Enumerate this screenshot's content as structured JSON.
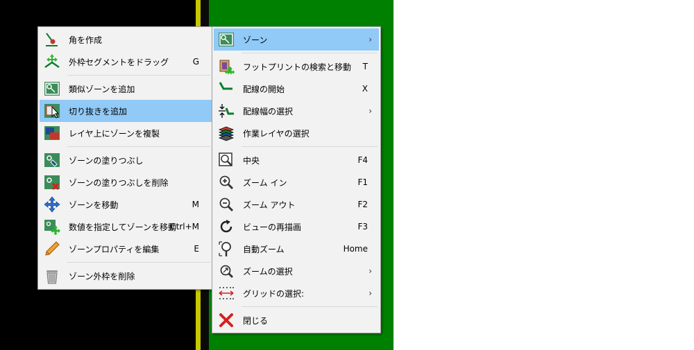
{
  "left_menu": {
    "items": [
      {
        "label": "角を作成",
        "shortcut": "",
        "icon": "create-corner-icon"
      },
      {
        "label": "外枠セグメントをドラッグ",
        "shortcut": "G",
        "icon": "drag-segment-icon"
      },
      {
        "label": "類似ゾーンを追加",
        "shortcut": "",
        "icon": "add-similar-zone-icon"
      },
      {
        "label": "切り抜きを追加",
        "shortcut": "",
        "icon": "add-cutout-icon"
      },
      {
        "label": "レイヤ上にゾーンを複製",
        "shortcut": "",
        "icon": "duplicate-zone-icon"
      },
      {
        "label": "ゾーンの塗りつぶし",
        "shortcut": "",
        "icon": "fill-zone-icon"
      },
      {
        "label": "ゾーンの塗りつぶしを削除",
        "shortcut": "",
        "icon": "unfill-zone-icon"
      },
      {
        "label": "ゾーンを移動",
        "shortcut": "M",
        "icon": "move-icon"
      },
      {
        "label": "数値を指定してゾーンを移動",
        "shortcut": "Ctrl+M",
        "icon": "move-exact-icon"
      },
      {
        "label": "ゾーンプロパティを編集",
        "shortcut": "E",
        "icon": "pencil-icon"
      },
      {
        "label": "ゾーン外枠を削除",
        "shortcut": "",
        "icon": "trash-icon"
      }
    ]
  },
  "right_menu": {
    "items": [
      {
        "label": "ゾーン",
        "shortcut": "",
        "icon": "zone-icon",
        "submenu": "›"
      },
      {
        "label": "フットプリントの検索と移動",
        "shortcut": "T",
        "icon": "footprint-move-icon"
      },
      {
        "label": "配線の開始",
        "shortcut": "X",
        "icon": "route-track-icon"
      },
      {
        "label": "配線幅の選択",
        "shortcut": "",
        "icon": "track-width-icon",
        "submenu": "›"
      },
      {
        "label": "作業レイヤの選択",
        "shortcut": "",
        "icon": "layers-icon"
      },
      {
        "label": "中央",
        "shortcut": "F4",
        "icon": "zoom-center-icon"
      },
      {
        "label": "ズーム イン",
        "shortcut": "F1",
        "icon": "zoom-in-icon"
      },
      {
        "label": "ズーム アウト",
        "shortcut": "F2",
        "icon": "zoom-out-icon"
      },
      {
        "label": "ビューの再描画",
        "shortcut": "F3",
        "icon": "redraw-icon"
      },
      {
        "label": "自動ズーム",
        "shortcut": "Home",
        "icon": "zoom-fit-icon"
      },
      {
        "label": "ズームの選択",
        "shortcut": "",
        "icon": "zoom-select-icon",
        "submenu": "›"
      },
      {
        "label": "グリッドの選択:",
        "shortcut": "",
        "icon": "grid-icon",
        "submenu": "›"
      },
      {
        "label": "閉じる",
        "shortcut": "",
        "icon": "close-icon"
      }
    ]
  },
  "colors": {
    "highlight": "#91c9f7",
    "pcb_green": "#008000",
    "track_yellow": "#c8c800"
  }
}
